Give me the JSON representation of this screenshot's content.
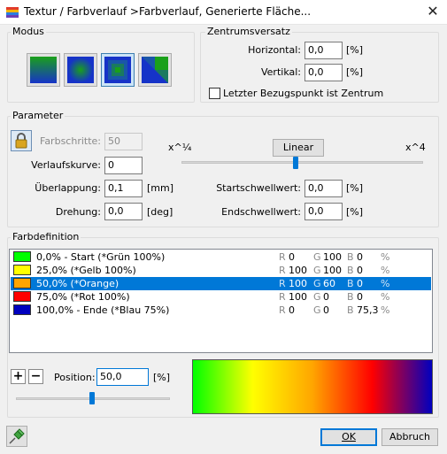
{
  "window": {
    "title": "Textur / Farbverlauf >Farbverlauf, Generierte Fläche...",
    "close_icon": "close-icon"
  },
  "modus": {
    "title": "Modus",
    "buttons": [
      {
        "name": "linear-mode",
        "icon": "linear-gradient-icon",
        "active": false
      },
      {
        "name": "circular-mode",
        "icon": "radial-gradient-icon",
        "active": false
      },
      {
        "name": "square-mode",
        "icon": "square-gradient-icon",
        "active": true
      },
      {
        "name": "conical-mode",
        "icon": "conical-gradient-icon",
        "active": false
      }
    ]
  },
  "zentrum": {
    "title": "Zentrumsversatz",
    "horizontal_label": "Horizontal:",
    "horizontal_value": "0,0",
    "horizontal_unit": "[%]",
    "vertikal_label": "Vertikal:",
    "vertikal_value": "0,0",
    "vertikal_unit": "[%]",
    "checkbox_label": "Letzter Bezugspunkt ist Zentrum",
    "checkbox_checked": false
  },
  "parameter": {
    "title": "Parameter",
    "farbschritte_label": "Farbschritte:",
    "farbschritte_value": "50",
    "verlaufskurve_label": "Verlaufskurve:",
    "verlaufskurve_value": "0",
    "ueberlappung_label": "Überlappung:",
    "ueberlappung_value": "0,1",
    "ueberlappung_unit": "[mm]",
    "drehung_label": "Drehung:",
    "drehung_value": "0,0",
    "drehung_unit": "[deg]",
    "curve_min_label": "x^¼",
    "curve_max_label": "x^4",
    "linear_button": "Linear",
    "curve_slider_value": 0.5,
    "startschwellwert_label": "Startschwellwert:",
    "startschwellwert_value": "0,0",
    "startschwellwert_unit": "[%]",
    "endschwellwert_label": "Endschwellwert:",
    "endschwellwert_value": "0,0",
    "endschwellwert_unit": "[%]"
  },
  "farbdefinition": {
    "title": "Farbdefinition",
    "rows": [
      {
        "label": "0,0% - Start (*Grün 100%)",
        "color": "#00ff00",
        "r": "0",
        "g": "100",
        "b": "0",
        "pct": "%",
        "selected": false
      },
      {
        "label": "25,0% (*Gelb 100%)",
        "color": "#ffff00",
        "r": "100",
        "g": "100",
        "b": "0",
        "pct": "%",
        "selected": false
      },
      {
        "label": "50,0% (*Orange)",
        "color": "#ffa500",
        "r": "100",
        "g": "60",
        "b": "0",
        "pct": "%",
        "selected": true
      },
      {
        "label": "75,0% (*Rot 100%)",
        "color": "#ff0000",
        "r": "100",
        "g": "0",
        "b": "0",
        "pct": "%",
        "selected": false
      },
      {
        "label": "100,0% - Ende (*Blau 75%)",
        "color": "#0000bf",
        "r": "0",
        "g": "0",
        "b": "75,3",
        "pct": "%",
        "selected": false
      }
    ],
    "channel_labels": {
      "r": "R",
      "g": "G",
      "b": "B"
    },
    "position_label": "Position:",
    "position_value": "50,0",
    "position_unit": "[%]",
    "position_slider_value": 0.5
  },
  "footer": {
    "ok_label": "OK",
    "cancel_label": "Abbruch",
    "pin_icon": "pin-icon"
  },
  "colors": {
    "accent": "#0078d7",
    "lock": "#d9a520"
  }
}
